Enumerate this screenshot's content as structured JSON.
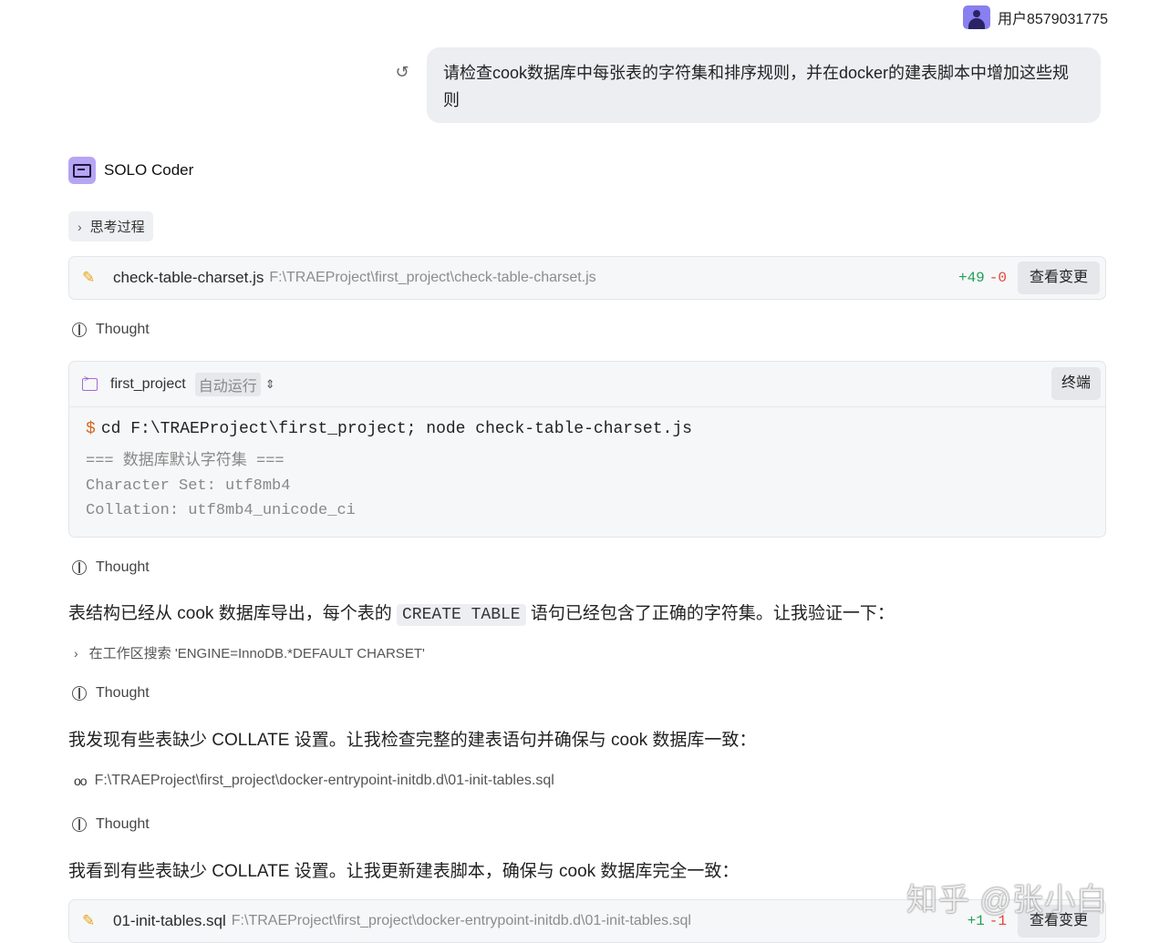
{
  "user": {
    "name": "用户8579031775"
  },
  "message": {
    "text": "请检查cook数据库中每张表的字符集和排序规则，并在docker的建表脚本中增加这些规则"
  },
  "agent": {
    "name": "SOLO Coder"
  },
  "thinking": {
    "label": "思考过程"
  },
  "file_change_1": {
    "file": "check-table-charset.js",
    "path": "F:\\TRAEProject\\first_project\\check-table-charset.js",
    "added": "+49",
    "removed": "-0",
    "button": "查看变更"
  },
  "thought_label": "Thought",
  "terminal": {
    "project": "first_project",
    "mode": "自动运行",
    "button": "终端",
    "prompt": "$",
    "command": "cd F:\\TRAEProject\\first_project; node check-table-charset.js",
    "output": [
      "=== 数据库默认字符集 ===",
      "Character Set: utf8mb4",
      "Collation: utf8mb4_unicode_ci"
    ]
  },
  "para1": {
    "before": "表结构已经从 cook 数据库导出，每个表的 ",
    "code": "CREATE TABLE",
    "after": " 语句已经包含了正确的字符集。让我验证一下："
  },
  "search": {
    "text": "在工作区搜索 'ENGINE=InnoDB.*DEFAULT CHARSET'"
  },
  "para2": {
    "text": "我发现有些表缺少 COLLATE 设置。让我检查完整的建表语句并确保与 cook 数据库一致："
  },
  "read_file": {
    "path": "F:\\TRAEProject\\first_project\\docker-entrypoint-initdb.d\\01-init-tables.sql"
  },
  "para3": {
    "text": "我看到有些表缺少 COLLATE 设置。让我更新建表脚本，确保与 cook 数据库完全一致："
  },
  "file_change_2": {
    "file": "01-init-tables.sql",
    "path": "F:\\TRAEProject\\first_project\\docker-entrypoint-initdb.d\\01-init-tables.sql",
    "added": "+1",
    "removed": "-1",
    "button": "查看变更"
  },
  "watermark": "知乎 @张小白"
}
